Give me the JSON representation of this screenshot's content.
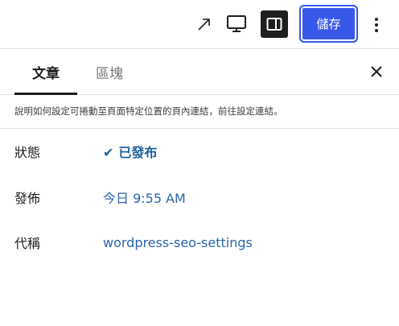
{
  "toolbar": {
    "external_link_icon": "arrow-up-right-icon",
    "preview_icon": "desktop-icon",
    "settings_icon": "sidebar-toggle-icon",
    "save_label": "儲存",
    "more_icon": "vertical-ellipsis-icon"
  },
  "panel": {
    "tabs": [
      {
        "label": "文章",
        "active": true
      },
      {
        "label": "區塊",
        "active": false
      }
    ],
    "close_icon": "close-icon",
    "description": "說明如何設定可捲動至頁面特定位置的頁內連結，前往設定連結。",
    "rows": [
      {
        "label": "狀態",
        "value": "已發布",
        "check": "✔"
      },
      {
        "label": "發佈",
        "value": "今日 9:55 AM"
      },
      {
        "label": "代稱",
        "value": "wordpress-seo-settings"
      }
    ]
  },
  "colors": {
    "accent": "#3858e9",
    "link": "#2a64ad",
    "border": "#e0e0e0"
  }
}
